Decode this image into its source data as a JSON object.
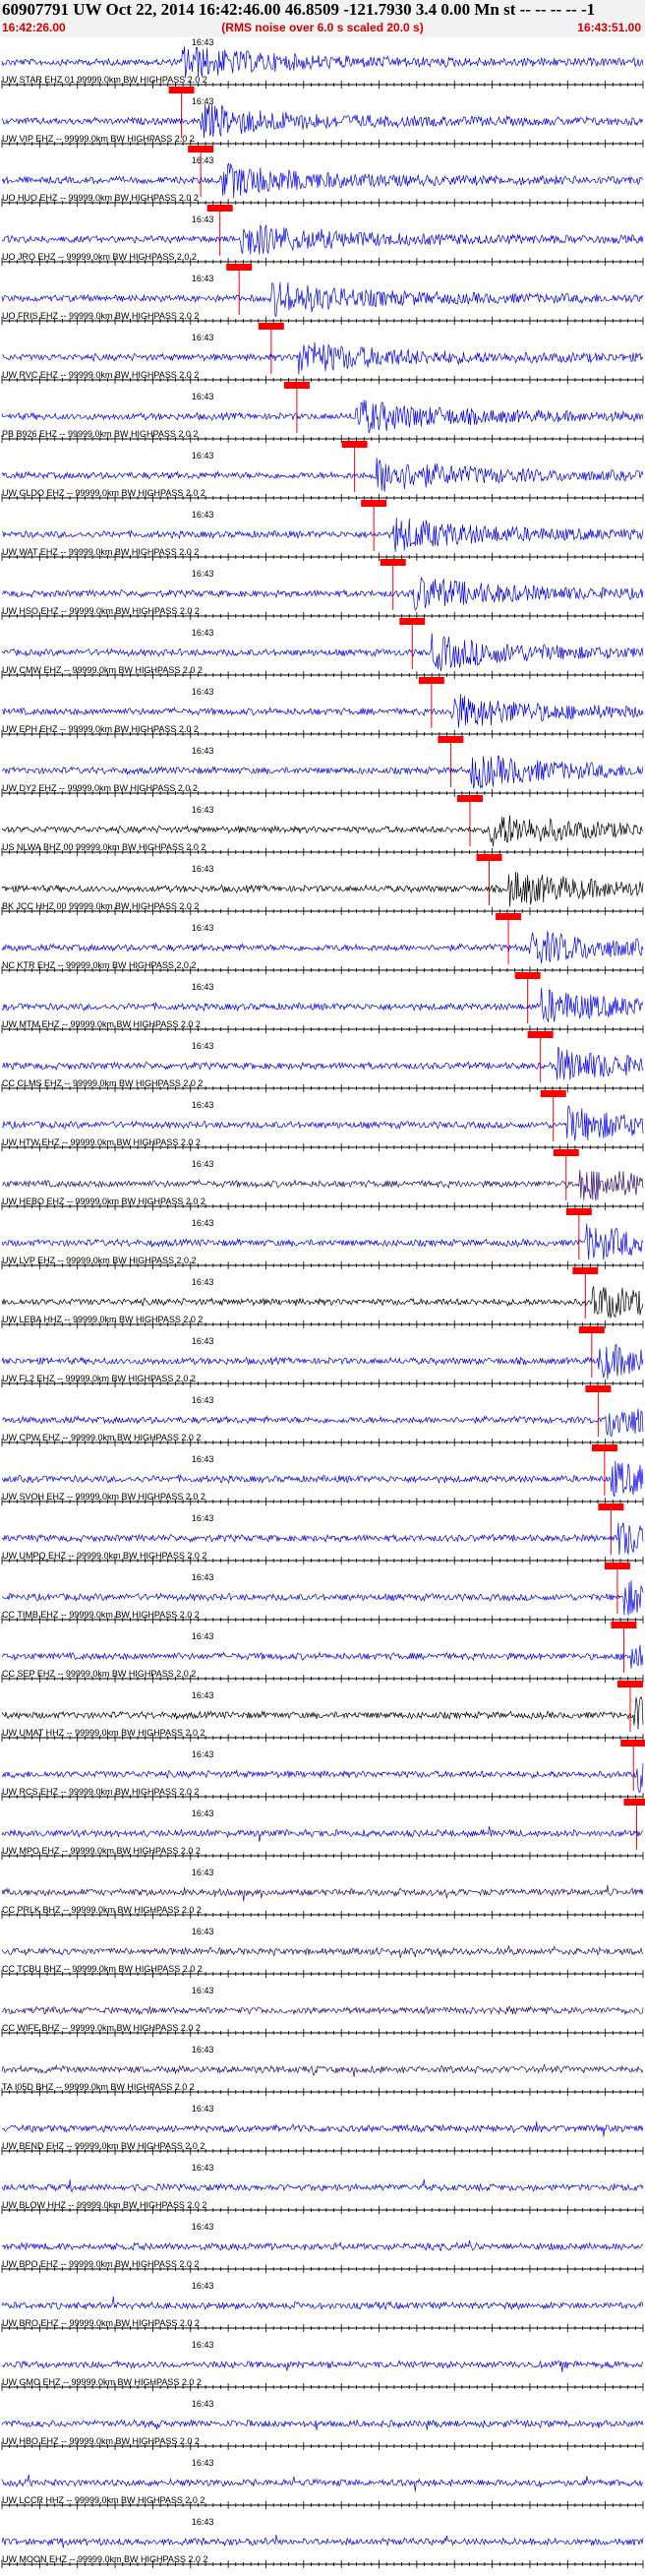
{
  "header": {
    "title": "60907791 UW Oct 22, 2014 16:42:46.00   46.8509 -121.7930  3.4 0.00 Mn st -- -- -- -- -1",
    "start_time": "16:42:26.00",
    "subtitle": "(RMS noise over 6.0 s scaled 20.0 s)",
    "end_time": "16:43:51.00"
  },
  "colors": {
    "blue": "#0000ee",
    "black": "#000000",
    "purple": "#2a0a70",
    "pick": "#ff0000",
    "axis": "#000000"
  },
  "chart_data": {
    "type": "line",
    "x_unit": "time",
    "x_range": [
      "16:42:26.00",
      "16:43:51.00"
    ],
    "time_tick_label": "16:43",
    "grid": false,
    "traces": [
      {
        "label": "UW STAR EHZ 01 99999.0km BW  HIGHPASS  2.0  2",
        "color": "blue",
        "pick": 0.28
      },
      {
        "label": "UW VIP EHZ -- 99999.0km BW  HIGHPASS  2.0  2",
        "color": "blue",
        "pick": 0.31
      },
      {
        "label": "UO HUO EHZ -- 99999.0km BW  HIGHPASS  2.0  2",
        "color": "blue",
        "pick": 0.34
      },
      {
        "label": "UO JRO EHZ -- 99999.0km BW  HIGHPASS  2.0  2",
        "color": "blue",
        "pick": 0.37
      },
      {
        "label": "UO FRIS EHZ -- 99999.0km BW  HIGHPASS  2.0  2",
        "color": "blue",
        "pick": 0.42
      },
      {
        "label": "UW RVC EHZ -- 99999.0km BW  HIGHPASS  2.0  2",
        "color": "blue",
        "pick": 0.46
      },
      {
        "label": "PB B926 EHZ -- 99999.0km BW  HIGHPASS  2.0  2",
        "color": "blue",
        "pick": 0.55
      },
      {
        "label": "UW GLDO EHZ -- 99999.0km BW  HIGHPASS  2.0  2",
        "color": "blue",
        "pick": 0.58
      },
      {
        "label": "UW WAT EHZ -- 99999.0km BW  HIGHPASS  2.0  2",
        "color": "blue",
        "pick": 0.61
      },
      {
        "label": "UW HSO EHZ -- 99999.0km BW  HIGHPASS  2.0  2",
        "color": "blue",
        "pick": 0.64
      },
      {
        "label": "UW CMW EHZ -- 99999.0km BW  HIGHPASS  2.0  2",
        "color": "blue",
        "pick": 0.67
      },
      {
        "label": "UW EPH EHZ -- 99999.0km BW  HIGHPASS  2.0  2",
        "color": "blue",
        "pick": 0.7
      },
      {
        "label": "UW DY2 EHZ -- 99999.0km BW  HIGHPASS  2.0  2",
        "color": "blue",
        "pick": 0.73
      },
      {
        "label": "US NLWA BHZ 00 99999.0km BW  HIGHPASS  2.0  2",
        "color": "black",
        "pick": 0.76
      },
      {
        "label": "BK JCC HHZ 00 99999.0km BW  HIGHPASS  2.0  2",
        "color": "black",
        "pick": 0.79
      },
      {
        "label": "NC KTR EHZ -- 99999.0km BW  HIGHPASS  2.0  2",
        "color": "blue",
        "pick": 0.82
      },
      {
        "label": "UW MTM EHZ -- 99999.0km BW  HIGHPASS  2.0  2",
        "color": "blue",
        "pick": 0.84
      },
      {
        "label": "CC CLMS EHZ -- 99999.0km BW  HIGHPASS  2.0  2",
        "color": "blue",
        "pick": 0.86
      },
      {
        "label": "UW HTW EHZ -- 99999.0km BW  HIGHPASS  2.0  2",
        "color": "blue",
        "pick": 0.88
      },
      {
        "label": "UW HEBO EHZ -- 99999.0km BW  HIGHPASS  2.0  2",
        "color": "purple",
        "pick": 0.9
      },
      {
        "label": "UW LVP EHZ -- 99999.0km BW  HIGHPASS  2.0  2",
        "color": "blue",
        "pick": 0.91
      },
      {
        "label": "UW LEBA HHZ -- 99999.0km BW  HIGHPASS  2.0  2",
        "color": "black",
        "pick": 0.92
      },
      {
        "label": "UW FL2 EHZ -- 99999.0km BW  HIGHPASS  2.0  2",
        "color": "blue",
        "pick": 0.93
      },
      {
        "label": "UW CPW EHZ -- 99999.0km BW  HIGHPASS  2.0  2",
        "color": "blue",
        "pick": 0.94
      },
      {
        "label": "UW SVOH EHZ -- 99999.0km BW  HIGHPASS  2.0  2",
        "color": "blue",
        "pick": 0.95
      },
      {
        "label": "UW UMPQ EHZ -- 99999.0km BW  HIGHPASS  2.0  2",
        "color": "blue",
        "pick": 0.96
      },
      {
        "label": "CC TIMB EHZ -- 99999.0km BW  HIGHPASS  2.0  2",
        "color": "blue",
        "pick": 0.97
      },
      {
        "label": "CC SEP EHZ -- 99999.0km BW  HIGHPASS  2.0  2",
        "color": "blue",
        "pick": 0.98
      },
      {
        "label": "UW UMAT HHZ -- 99999.0km BW  HIGHPASS  2.0  2",
        "color": "black",
        "pick": 0.985
      },
      {
        "label": "UW RCS EHZ -- 99999.0km BW  HIGHPASS  2.0  2",
        "color": "blue",
        "pick": 0.99
      },
      {
        "label": "UW MPO EHZ -- 99999.0km BW  HIGHPASS  2.0  2",
        "color": "blue",
        "pick": null
      },
      {
        "label": "CC PRLK BHZ -- 99999.0km BW  HIGHPASS  2.0  2",
        "color": "purple",
        "pick": null
      },
      {
        "label": "CC TCBU BHZ -- 99999.0km BW  HIGHPASS  2.0  2",
        "color": "purple",
        "pick": null
      },
      {
        "label": "CC WIFE BHZ -- 99999.0km BW  HIGHPASS  2.0  2",
        "color": "purple",
        "pick": null
      },
      {
        "label": "TA I05D BHZ -- 99999.0km BW  HIGHPASS  2.0  2",
        "color": "purple",
        "pick": null
      },
      {
        "label": "UW BEND EHZ -- 99999.0km BW  HIGHPASS  2.0  2",
        "color": "blue",
        "pick": null
      },
      {
        "label": "UW BLOW HHZ -- 99999.0km BW  HIGHPASS  2.0  2",
        "color": "blue",
        "pick": null
      },
      {
        "label": "UW BPO EHZ -- 99999.0km BW  HIGHPASS  2.0  2",
        "color": "blue",
        "pick": null
      },
      {
        "label": "UW BRO EHZ -- 99999.0km BW  HIGHPASS  2.0  2",
        "color": "blue",
        "pick": null
      },
      {
        "label": "UW GMO EHZ -- 99999.0km BW  HIGHPASS  2.0  2",
        "color": "blue",
        "pick": null
      },
      {
        "label": "UW HBO EHZ -- 99999.0km BW  HIGHPASS  2.0  2",
        "color": "blue",
        "pick": null
      },
      {
        "label": "UW LCCR HHZ -- 99999.0km BW  HIGHPASS  2.0  2",
        "color": "blue",
        "pick": null
      },
      {
        "label": "UW MOON EHZ -- 99999.0km BW  HIGHPASS  2.0  2",
        "color": "blue",
        "pick": null
      }
    ]
  }
}
